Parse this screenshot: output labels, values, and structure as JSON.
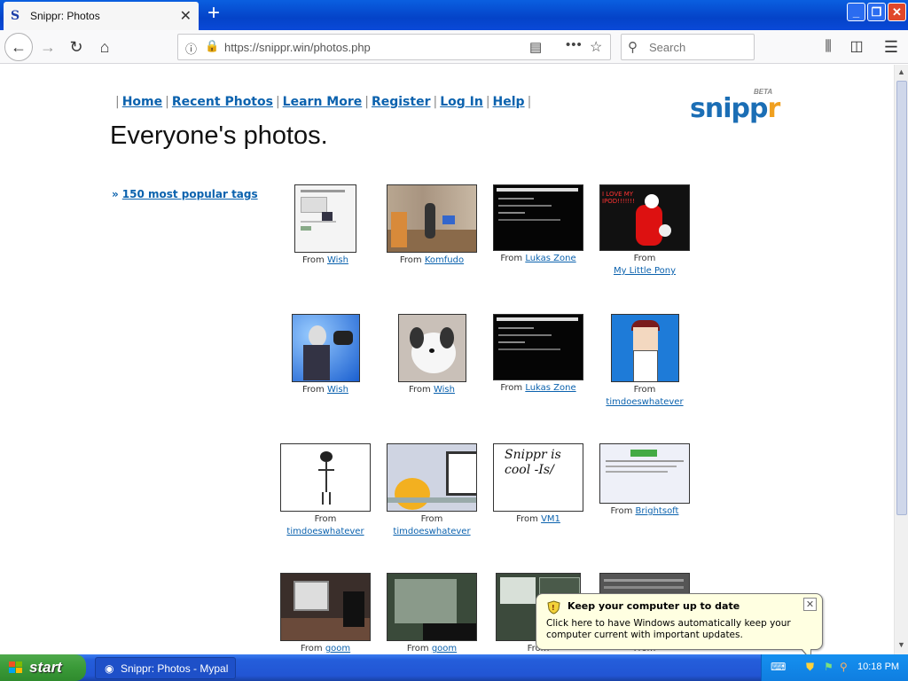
{
  "browser": {
    "tab_title": "Snippr: Photos",
    "tab_favicon": "S",
    "tab_close": "✕",
    "new_tab": "+",
    "url": "https://snippr.win/photos.php",
    "search_placeholder": "Search"
  },
  "page": {
    "nav": [
      {
        "label": "Home"
      },
      {
        "label": "Recent Photos"
      },
      {
        "label": "Learn More"
      },
      {
        "label": "Register"
      },
      {
        "label": "Log In"
      },
      {
        "label": "Help"
      }
    ],
    "logo": {
      "word_a": "snipp",
      "word_b": "r",
      "beta": "BETA"
    },
    "title": "Everyone's photos.",
    "tags_link": "150 most popular tags",
    "from_label": "From",
    "photos": [
      {
        "from": "Wish",
        "thumb": "screenshot-light"
      },
      {
        "from": "Komfudo",
        "thumb": "room"
      },
      {
        "from": "Lukas Zone",
        "thumb": "screenshot-dark"
      },
      {
        "from": "My Little Pony",
        "thumb": "pony",
        "thumb_text": "I LOVE MY IPOD!!!!!!!"
      },
      {
        "from": "Wish",
        "thumb": "blue-figure"
      },
      {
        "from": "Wish",
        "thumb": "dog"
      },
      {
        "from": "Lukas Zone",
        "thumb": "screenshot-dark"
      },
      {
        "from": "timdoeswhatever",
        "thumb": "cartoon-boy"
      },
      {
        "from": "timdoeswhatever",
        "thumb": "stick-figure"
      },
      {
        "from": "timdoeswhatever",
        "thumb": "sad-face"
      },
      {
        "from": "VM1",
        "thumb": "handwriting",
        "thumb_text": "Snippr is cool -Is/"
      },
      {
        "from": "Brightsoft",
        "thumb": "webpage"
      },
      {
        "from": "goom",
        "thumb": "heater"
      },
      {
        "from": "goom",
        "thumb": "window"
      },
      {
        "from": "",
        "thumb": "screenshot-green"
      },
      {
        "from": "",
        "thumb": "screenshot-grey"
      }
    ]
  },
  "balloon": {
    "title": "Keep your computer up to date",
    "body": "Click here to have Windows automatically keep your computer current with important updates.",
    "close": "✕"
  },
  "taskbar": {
    "start": "start",
    "task": "Snippr: Photos - Mypal",
    "clock": "10:18 PM"
  },
  "colors": {
    "link": "#0b62ae",
    "logo_blue": "#1b6eb5",
    "logo_orange": "#f0a020"
  }
}
